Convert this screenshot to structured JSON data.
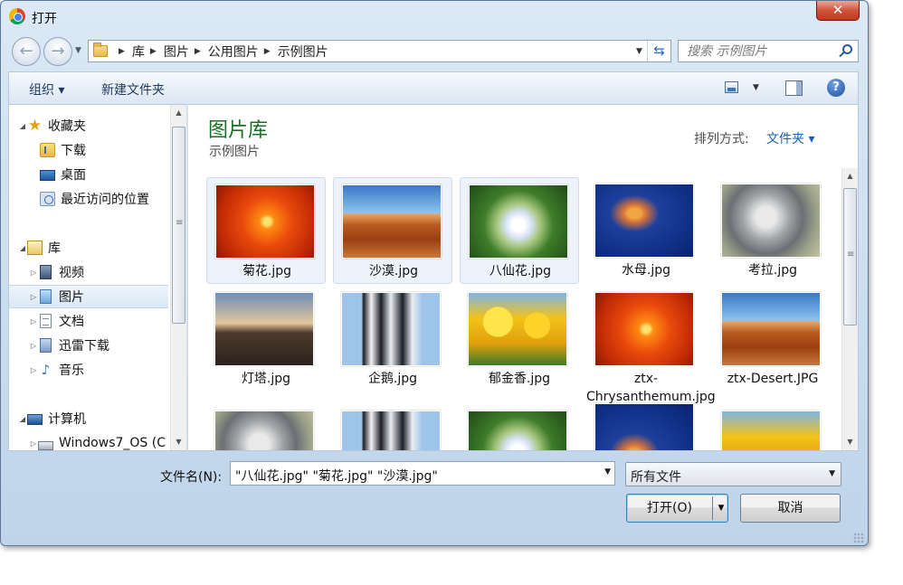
{
  "window": {
    "title": "打开",
    "close_label": "✕"
  },
  "nav": {
    "breadcrumb": [
      "库",
      "图片",
      "公用图片",
      "示例图片"
    ],
    "search_placeholder": "搜索 示例图片"
  },
  "toolbar": {
    "organize": "组织 ▾",
    "new_folder": "新建文件夹",
    "help": "?"
  },
  "sidebar": {
    "favorites": "收藏夹",
    "downloads": "下载",
    "desktop": "桌面",
    "recent": "最近访问的位置",
    "libraries": "库",
    "videos": "视频",
    "pictures": "图片",
    "documents": "文档",
    "thunder": "迅雷下载",
    "music": "音乐",
    "computer": "计算机",
    "drive": "Windows7_OS (C"
  },
  "content": {
    "title": "图片库",
    "subtitle": "示例图片",
    "arrange_label": "排列方式:",
    "arrange_value": "文件夹 ▾",
    "files": [
      {
        "name": "菊花.jpg",
        "selected": true
      },
      {
        "name": "沙漠.jpg",
        "selected": true
      },
      {
        "name": "八仙花.jpg",
        "selected": true
      },
      {
        "name": "水母.jpg",
        "selected": false
      },
      {
        "name": "考拉.jpg",
        "selected": false
      },
      {
        "name": "灯塔.jpg",
        "selected": false
      },
      {
        "name": "企鹅.jpg",
        "selected": false
      },
      {
        "name": "郁金香.jpg",
        "selected": false
      },
      {
        "name": "ztx-Chrysanthemum.jpg",
        "selected": false
      },
      {
        "name": "ztx-Desert.JPG",
        "selected": false
      }
    ]
  },
  "bottom": {
    "filename_label": "文件名(N):",
    "filename_value": "\"八仙花.jpg\" \"菊花.jpg\" \"沙漠.jpg\"",
    "filetype_value": "所有文件",
    "open_label": "打开(O)",
    "cancel_label": "取消"
  }
}
